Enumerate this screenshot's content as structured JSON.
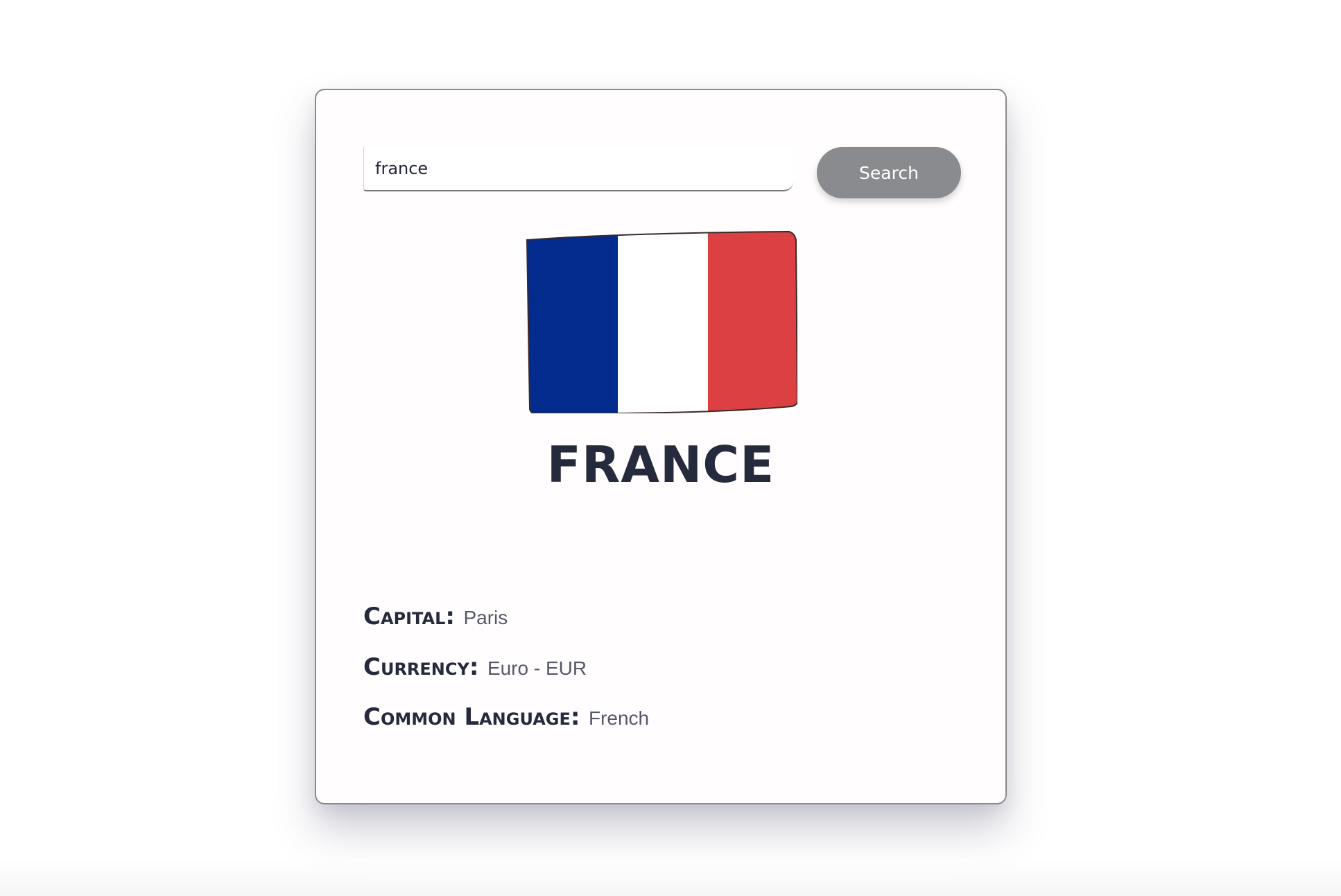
{
  "search": {
    "value": "france",
    "button_label": "Search"
  },
  "country": {
    "name": "FRANCE",
    "flag": {
      "icon": "france-flag",
      "colors": [
        "#032a8d",
        "#ffffff",
        "#dc4042"
      ]
    }
  },
  "details": {
    "capital": {
      "label": "Capital:",
      "value": "Paris"
    },
    "currency": {
      "label": "Currency:",
      "value": "Euro - EUR"
    },
    "language": {
      "label": "Common Language:",
      "value": "French"
    }
  }
}
